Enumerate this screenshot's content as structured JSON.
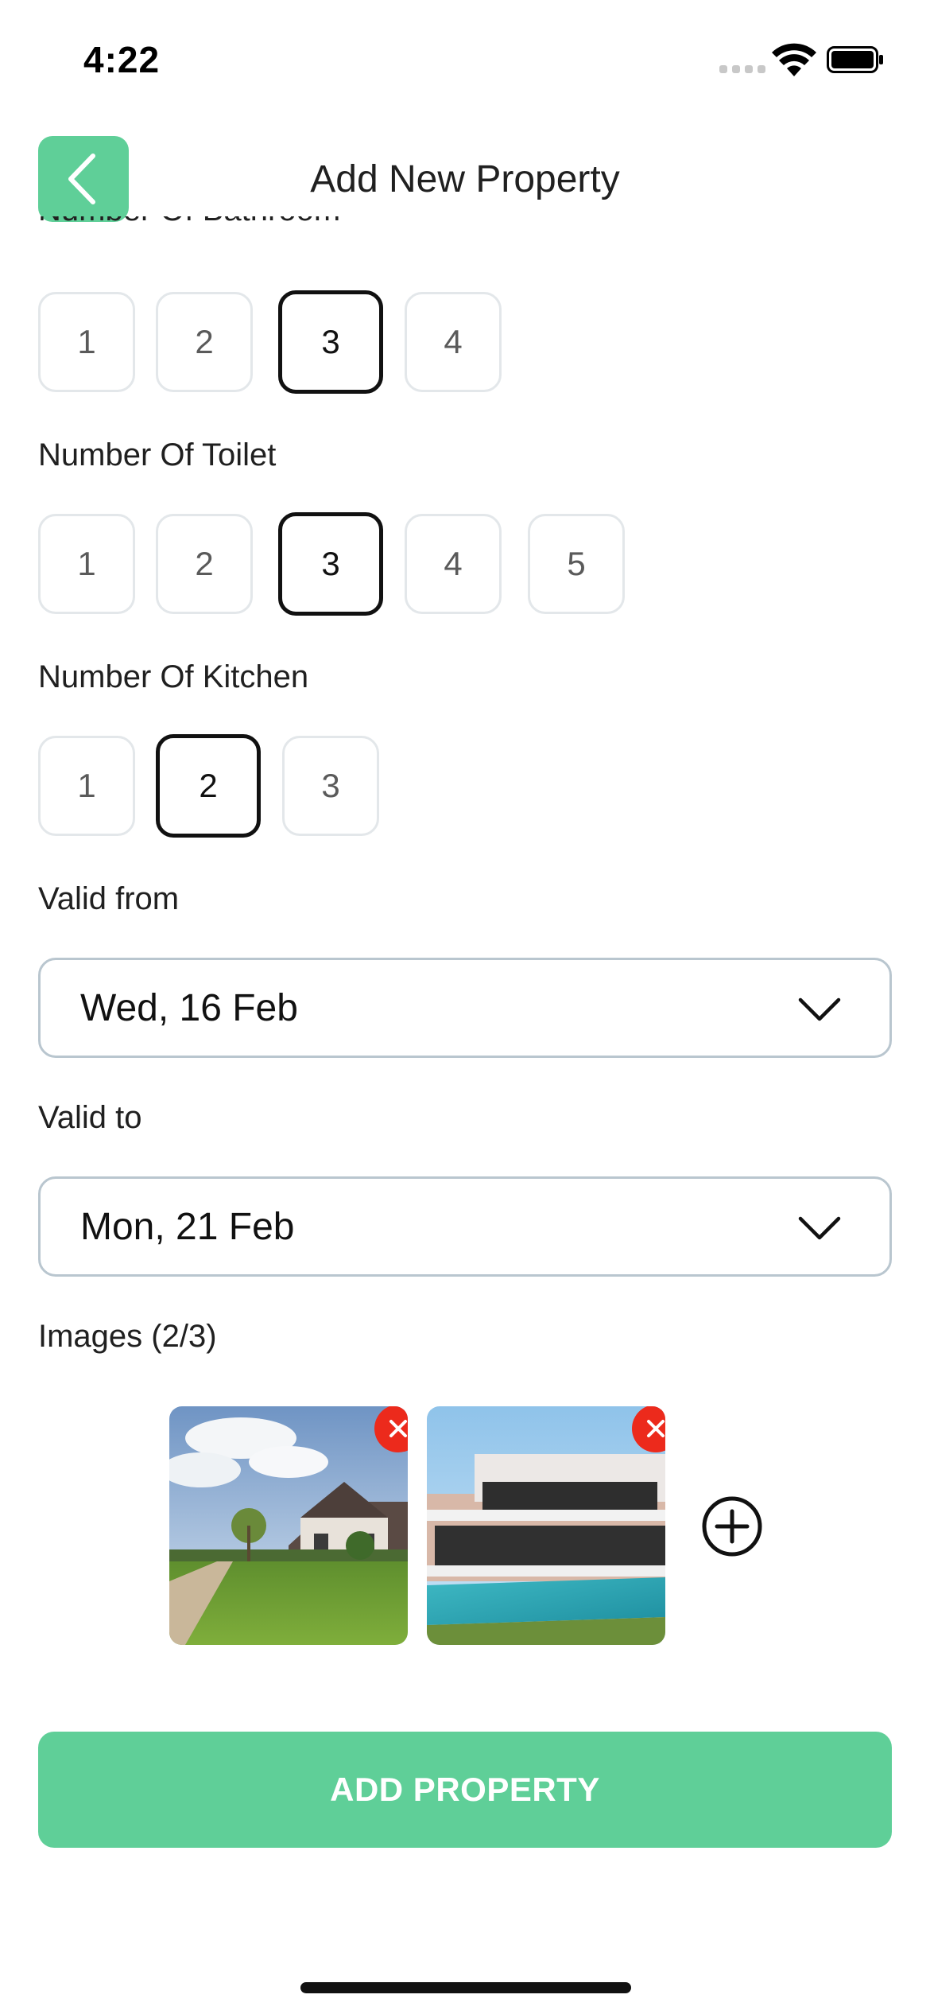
{
  "status_bar": {
    "time": "4:22"
  },
  "header": {
    "title": "Add New Property",
    "back_icon": "chevron-left-icon"
  },
  "bathroom": {
    "label": "Number Of Bathroom",
    "options": [
      "1",
      "2",
      "3",
      "4"
    ],
    "selected": "3"
  },
  "toilet": {
    "label": "Number Of Toilet",
    "options": [
      "1",
      "2",
      "3",
      "4",
      "5"
    ],
    "selected": "3"
  },
  "kitchen": {
    "label": "Number Of Kitchen",
    "options": [
      "1",
      "2",
      "3"
    ],
    "selected": "2"
  },
  "valid_from": {
    "label": "Valid from",
    "value": "Wed, 16 Feb"
  },
  "valid_to": {
    "label": "Valid to",
    "value": "Mon, 21 Feb"
  },
  "images": {
    "label": "Images (2/3)",
    "items": [
      "house-photo",
      "modern-villa-pool-photo"
    ],
    "add_icon": "plus-circle-icon",
    "remove_icon": "close-icon"
  },
  "submit": {
    "label": "ADD PROPERTY"
  },
  "colors": {
    "accent": "#5fcf98",
    "remove": "#ec2a1c",
    "selected_border": "#111111"
  }
}
